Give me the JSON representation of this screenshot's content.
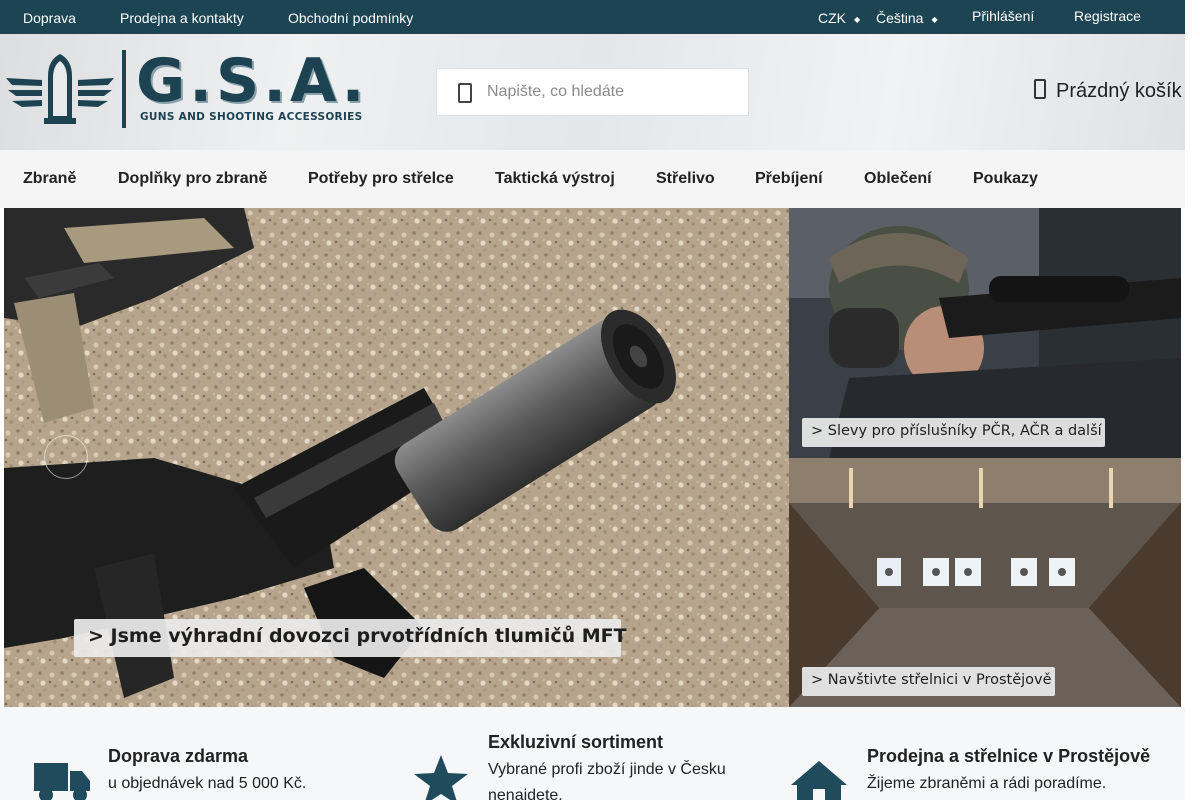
{
  "topbar": {
    "links": [
      "Doprava",
      "Prodejna a kontakty",
      "Obchodní podmínky"
    ],
    "currency": "CZK",
    "language": "Čeština",
    "login": "Přihlášení",
    "register": "Registrace"
  },
  "header": {
    "logo_text": "G.S.A.",
    "logo_tagline": "GUNS AND SHOOTING ACCESSORIES",
    "search_placeholder": "Napište, co hledáte",
    "cart_label": "Prázdný košík"
  },
  "nav": {
    "items": [
      "Zbraně",
      "Doplňky pro zbraně",
      "Potřeby pro střelce",
      "Taktická výstroj",
      "Střelivo",
      "Přebíjení",
      "Oblečení",
      "Poukazy"
    ]
  },
  "banners": {
    "main": "> Jsme výhradní dovozci prvotřídních tlumičů MFT",
    "side_top": "> Slevy pro příslušníky PČR, AČR a další",
    "side_bottom": "> Navštivte střelnici v Prostějově"
  },
  "benefits": [
    {
      "icon": "truck-icon",
      "title": "Doprava zdarma",
      "text": "u objednávek nad 5 000 Kč."
    },
    {
      "icon": "star-icon",
      "title": "Exkluzivní sortiment",
      "text": "Vybrané profi zboží jinde v Česku nenajdete."
    },
    {
      "icon": "house-icon",
      "title": "Prodejna a střelnice v Prostějově",
      "text": "Žijeme zbraněmi a rádi poradíme."
    }
  ],
  "colors": {
    "topbar": "#1c4453",
    "accent": "#1d4352",
    "icon": "#1f4b5c"
  }
}
